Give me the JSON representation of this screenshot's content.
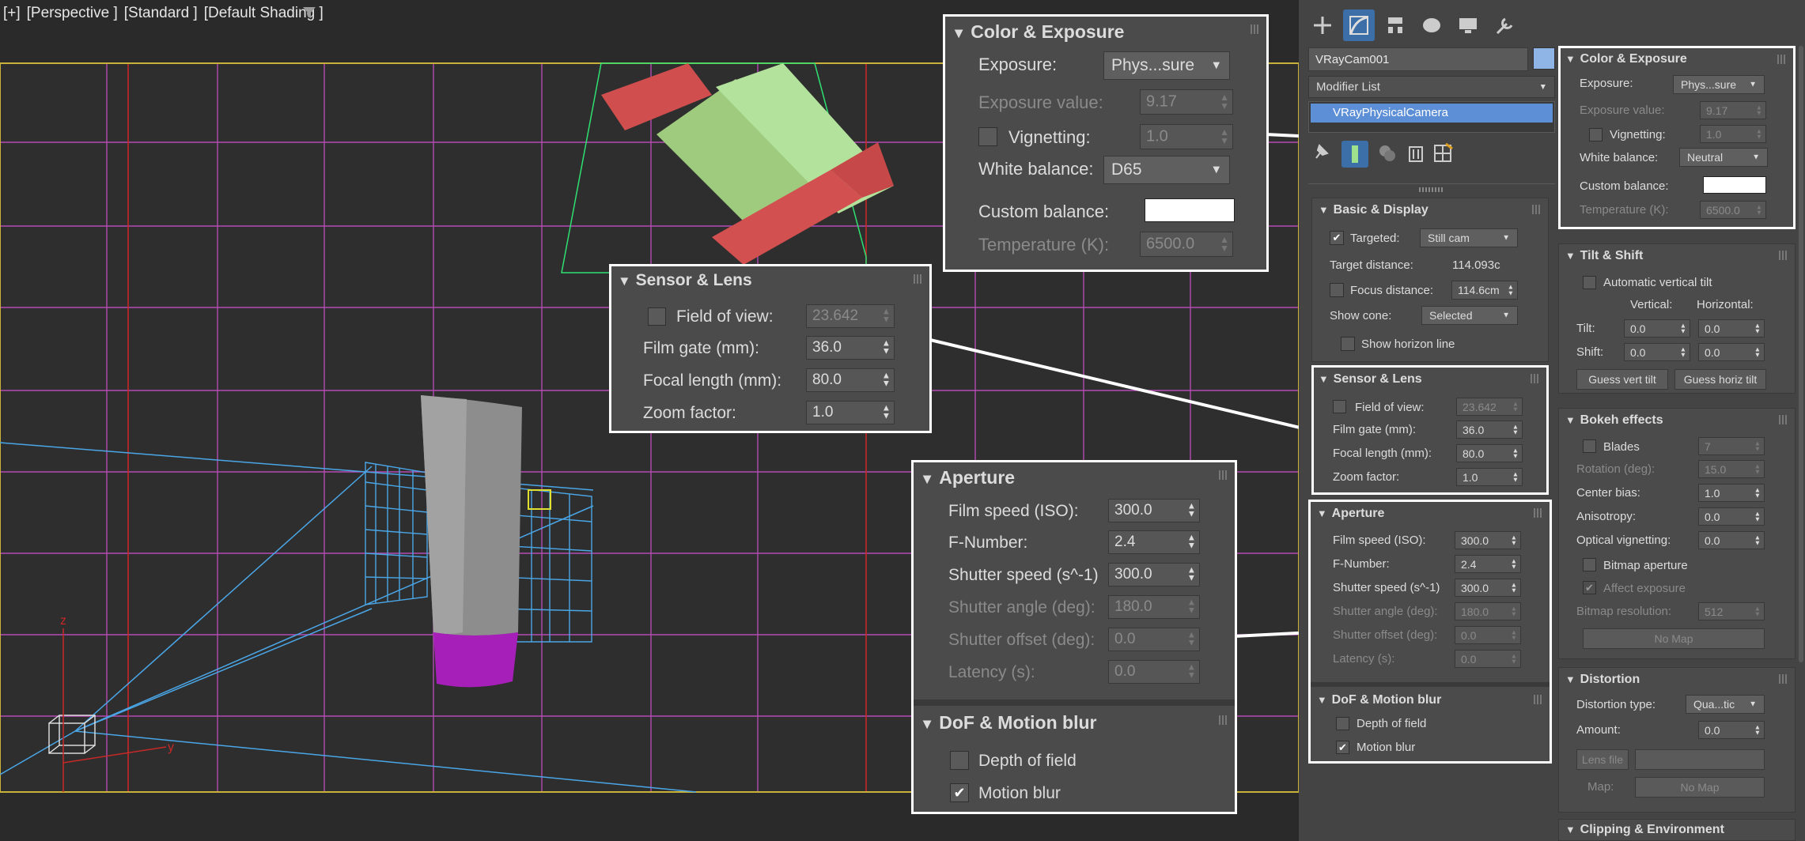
{
  "viewport": {
    "label_parts": [
      "[+]",
      "[Perspective ]",
      "[Standard ]",
      "[Default Shading ]"
    ],
    "axis_z": "z",
    "axis_y": "y"
  },
  "panel": {
    "object_name": "VRayCam001",
    "modifier_list": "Modifier List",
    "stack_item": "VRayPhysicalCamera",
    "tabs": [
      "create-icon",
      "modify-icon",
      "hierarchy-icon",
      "motion-icon",
      "display-icon",
      "utilities-icon"
    ]
  },
  "basic": {
    "title": "Basic & Display",
    "targeted": "Targeted:",
    "targeted_val": "Still cam",
    "target_distance": "Target distance:",
    "target_distance_val": "114.093c",
    "focus_distance": "Focus distance:",
    "focus_distance_val": "114.6cm",
    "show_cone": "Show cone:",
    "show_cone_val": "Selected",
    "horizon": "Show horizon line"
  },
  "sensor": {
    "title": "Sensor & Lens",
    "fov": "Field of view:",
    "fov_val": "23.642",
    "film_gate": "Film gate (mm):",
    "film_gate_val": "36.0",
    "focal": "Focal length (mm):",
    "focal_val": "80.0",
    "zoom": "Zoom factor:",
    "zoom_val": "1.0"
  },
  "aperture": {
    "title": "Aperture",
    "iso": "Film speed (ISO):",
    "iso_val": "300.0",
    "fnum": "F-Number:",
    "fnum_val": "2.4",
    "shutter": "Shutter speed (s^-1)",
    "shutter_val": "300.0",
    "angle": "Shutter angle (deg):",
    "angle_val": "180.0",
    "offset": "Shutter offset (deg):",
    "offset_val": "0.0",
    "latency": "Latency (s):",
    "latency_val": "0.0"
  },
  "dof": {
    "title": "DoF & Motion blur",
    "depth": "Depth of field",
    "motion": "Motion blur"
  },
  "color": {
    "title": "Color & Exposure",
    "exposure": "Exposure:",
    "exposure_val": "Phys...sure",
    "ev": "Exposure value:",
    "ev_val": "9.17",
    "vignetting": "Vignetting:",
    "vignetting_val": "1.0",
    "wb": "White balance:",
    "wb_panel_val": "Neutral",
    "wb_zoom_val": "D65",
    "custom": "Custom balance:",
    "temp": "Temperature (K):",
    "temp_val": "6500.0"
  },
  "tilt": {
    "title": "Tilt & Shift",
    "auto": "Automatic vertical tilt",
    "vertical": "Vertical:",
    "horizontal": "Horizontal:",
    "tilt": "Tilt:",
    "tilt_v": "0.0",
    "tilt_h": "0.0",
    "shift": "Shift:",
    "shift_v": "0.0",
    "shift_h": "0.0",
    "guess_v": "Guess vert tilt",
    "guess_h": "Guess horiz tilt"
  },
  "bokeh": {
    "title": "Bokeh effects",
    "blades": "Blades",
    "blades_val": "7",
    "rotation": "Rotation (deg):",
    "rotation_val": "15.0",
    "center": "Center bias:",
    "center_val": "1.0",
    "aniso": "Anisotropy:",
    "aniso_val": "0.0",
    "optvig": "Optical vignetting:",
    "optvig_val": "0.0",
    "bitmap": "Bitmap aperture",
    "affect": "Affect exposure",
    "bitmap_res": "Bitmap resolution:",
    "bitmap_res_val": "512",
    "nomap": "No Map"
  },
  "distortion": {
    "title": "Distortion",
    "type": "Distortion type:",
    "type_val": "Qua...tic",
    "amount": "Amount:",
    "amount_val": "0.0",
    "lensfile": "Lens file",
    "map": "Map:",
    "nomap": "No Map"
  },
  "clipping": {
    "title": "Clipping & Environment"
  },
  "colors": {
    "accent": "#3c6fa8",
    "grid": "#c24fc2",
    "red_axis": "#c82828",
    "cone": "#4aa6e6",
    "highlight": "#ffffff"
  }
}
